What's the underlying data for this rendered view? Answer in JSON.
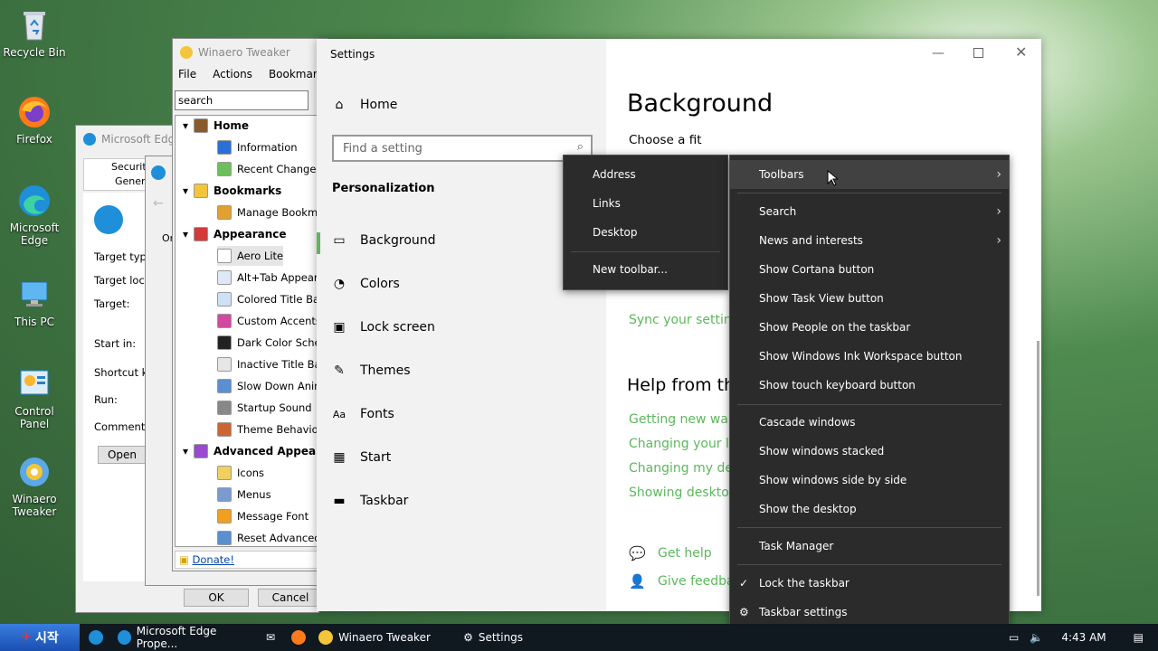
{
  "desktop": {
    "icons": [
      {
        "label": "Recycle Bin",
        "icon": "recycle-bin-icon"
      },
      {
        "label": "Firefox",
        "icon": "firefox-icon"
      },
      {
        "label": "Microsoft Edge",
        "icon": "edge-icon"
      },
      {
        "label": "This PC",
        "icon": "computer-icon"
      },
      {
        "label": "Control Panel",
        "icon": "control-panel-icon"
      },
      {
        "label": "Winaero Tweaker",
        "icon": "winaero-icon"
      }
    ]
  },
  "edge_props": {
    "title": "Microsoft Edge",
    "tabs": [
      "Security",
      "General"
    ],
    "labels": [
      "Target typ",
      "Target loc",
      "Target:",
      "Start in:",
      "Shortcut k",
      "Run:",
      "Comment:"
    ],
    "open_btn": "Open",
    "ok_btn": "OK",
    "cancel_btn": "Cancel",
    "partial_or": "Or"
  },
  "winaero": {
    "title": "Winaero Tweaker",
    "menu": [
      "File",
      "Actions",
      "Bookmarks"
    ],
    "search_value": "search",
    "tree": [
      {
        "label": "Home",
        "head": true
      },
      {
        "label": "Information"
      },
      {
        "label": "Recent Changes"
      },
      {
        "label": "Bookmarks",
        "head": true
      },
      {
        "label": "Manage Bookmark"
      },
      {
        "label": "Appearance",
        "head": true
      },
      {
        "label": "Aero Lite",
        "selected": true
      },
      {
        "label": "Alt+Tab Appearan"
      },
      {
        "label": "Colored Title Bars"
      },
      {
        "label": "Custom Accents"
      },
      {
        "label": "Dark Color Scheme"
      },
      {
        "label": "Inactive Title Bars"
      },
      {
        "label": "Slow Down Animat"
      },
      {
        "label": "Startup Sound"
      },
      {
        "label": "Theme Behavior"
      },
      {
        "label": "Advanced Appeara",
        "head": true
      },
      {
        "label": "Icons"
      },
      {
        "label": "Menus"
      },
      {
        "label": "Message Font"
      },
      {
        "label": "Reset Advanced A"
      }
    ],
    "donate": "Donate!"
  },
  "settings": {
    "title": "Settings",
    "home": "Home",
    "search_placeholder": "Find a setting",
    "section": "Personalization",
    "nav": [
      {
        "label": "Background",
        "icon": "image-icon"
      },
      {
        "label": "Colors",
        "icon": "palette-icon"
      },
      {
        "label": "Lock screen",
        "icon": "lock-screen-icon"
      },
      {
        "label": "Themes",
        "icon": "themes-icon"
      },
      {
        "label": "Fonts",
        "icon": "fonts-icon"
      },
      {
        "label": "Start",
        "icon": "start-icon"
      },
      {
        "label": "Taskbar",
        "icon": "taskbar-icon"
      }
    ],
    "page_title": "Background",
    "choose_fit": "Choose a fit",
    "sync_link": "Sync your settings",
    "help_title": "Help from th",
    "help_links": [
      "Getting new wallp",
      "Changing your lo",
      "Changing my des",
      "Showing desktop"
    ],
    "get_help": "Get help",
    "give_feedback": "Give feedbac"
  },
  "submenu": {
    "items": [
      "Address",
      "Links",
      "Desktop"
    ],
    "new_toolbar": "New toolbar..."
  },
  "context_menu": {
    "toolbars": "Toolbars",
    "search": "Search",
    "news": "News and interests",
    "show_group": [
      "Show Cortana button",
      "Show Task View button",
      "Show People on the taskbar",
      "Show Windows Ink Workspace button",
      "Show touch keyboard button"
    ],
    "window_group": [
      "Cascade windows",
      "Show windows stacked",
      "Show windows side by side",
      "Show the desktop"
    ],
    "task_manager": "Task Manager",
    "lock": "Lock the taskbar",
    "taskbar_settings": "Taskbar settings"
  },
  "taskbar": {
    "start": "시작",
    "items": [
      "Microsoft Edge Prope...",
      "Winaero Tweaker",
      "Settings"
    ],
    "time": "4:43 AM"
  }
}
